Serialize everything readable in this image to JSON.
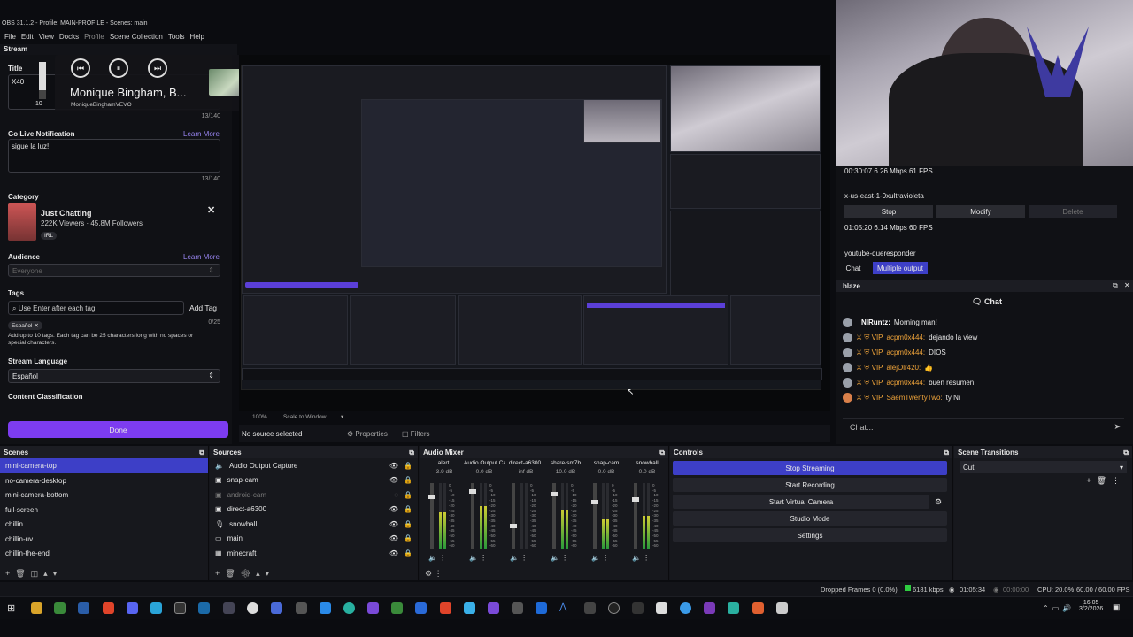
{
  "window": {
    "title": "OBS 31.1.2 - Profile: MAIN-PROFILE - Scenes: main"
  },
  "menu": [
    "File",
    "Edit",
    "View",
    "Docks",
    "Profile",
    "Scene Collection",
    "Tools",
    "Help"
  ],
  "stream_dock": {
    "header": "Stream",
    "title_label": "Title",
    "title_value": "X40",
    "title_count": "13/140",
    "golive_label": "Go Live Notification",
    "golive_link": "Learn More",
    "golive_value": "sigue la luz!",
    "golive_count": "13/140",
    "category_label": "Category",
    "category_name": "Just Chatting",
    "category_stats": "222K Viewers · 45.8M Followers",
    "category_tag": "IRL",
    "audience_label": "Audience",
    "audience_link": "Learn More",
    "audience_value": "Everyone",
    "tags_label": "Tags",
    "tags_placeholder": "Use Enter after each tag",
    "add_tag": "Add Tag",
    "tags_count": "0/25",
    "tag_chip": "Español",
    "tags_help": "Add up to 10 tags. Each tag can be 25 characters long with no spaces or special characters.",
    "lang_label": "Stream Language",
    "lang_value": "Español",
    "content_label": "Content Classification",
    "done": "Done"
  },
  "media": {
    "artist": "Monique Bingham, B...",
    "channel": "MoniqueBinghamVEVO",
    "volume": "10"
  },
  "preview": {
    "zoom": "100%",
    "scale": "Scale to Window",
    "no_source": "No source selected",
    "properties": "Properties",
    "filters": "Filters"
  },
  "right": {
    "time1": "00:30:07",
    "rate1": "6.26 Mbps",
    "fps1": "61 FPS",
    "server": "x-us-east-1-0xultravioleta",
    "stop": "Stop",
    "modify": "Modify",
    "delete": "Delete",
    "time2": "01:05:20",
    "rate2": "6.14 Mbps",
    "fps2": "60 FPS",
    "service": "youtube-queresponder",
    "tab_chat": "Chat",
    "tab_multi": "Multiple output",
    "chat_dock": "blaze",
    "chat_title": "Chat",
    "messages": [
      {
        "user": "NIRuntz:",
        "text": "Morning man!",
        "vip": false
      },
      {
        "user": "acpm0x444:",
        "text": "dejando la view",
        "vip": true
      },
      {
        "user": "acpm0x444:",
        "text": "DIOS",
        "vip": true
      },
      {
        "user": "alejOlr420:",
        "text": "👍",
        "vip": true
      },
      {
        "user": "acpm0x444:",
        "text": "buen resumen",
        "vip": true
      },
      {
        "user": "SaemTwentyTwo:",
        "text": "ty Ni",
        "vip": true
      }
    ],
    "chat_placeholder": "Chat..."
  },
  "scenes": {
    "header": "Scenes",
    "items": [
      "mini-camera-top",
      "no-camera-desktop",
      "mini-camera-bottom",
      "full-screen",
      "chillin",
      "chillin-uv",
      "chillin-the-end"
    ]
  },
  "sources": {
    "header": "Sources",
    "items": [
      "Audio Output Capture",
      "snap-cam",
      "android-cam",
      "direct-a6300",
      "snowball",
      "main",
      "minecraft"
    ]
  },
  "mixer": {
    "header": "Audio Mixer",
    "channels": [
      {
        "name": "alert",
        "db": "-3.9 dB",
        "level": 0.55
      },
      {
        "name": "Audio Output Captu",
        "db": "0.0 dB",
        "level": 0.65
      },
      {
        "name": "direct-a6300",
        "db": "-inf dB",
        "level": 0.0
      },
      {
        "name": "share-sm7b",
        "db": "10.0 dB",
        "level": 0.6
      },
      {
        "name": "snap-cam",
        "db": "0.0 dB",
        "level": 0.45
      },
      {
        "name": "snowball",
        "db": "0.0 dB",
        "level": 0.5
      }
    ],
    "scale": [
      "0",
      "-5",
      "-10",
      "-15",
      "-20",
      "-25",
      "-30",
      "-35",
      "-40",
      "-45",
      "-50",
      "-55",
      "-60"
    ]
  },
  "controls": {
    "header": "Controls",
    "buttons": [
      "Stop Streaming",
      "Start Recording",
      "Start Virtual Camera",
      "Studio Mode",
      "Settings"
    ]
  },
  "transitions": {
    "header": "Scene Transitions",
    "value": "Cut"
  },
  "status": {
    "dropped": "Dropped Frames 0 (0.0%)",
    "kbps": "6181 kbps",
    "live": "01:05:34",
    "rec": "00:00:00",
    "cpu": "CPU: 20.0%",
    "fps": "60.00 / 60.00 FPS"
  },
  "clock": {
    "time": "16:05",
    "date": "3/2/2026"
  },
  "colors": {
    "accent": "#3d3fc7",
    "purple": "#7d3cf0",
    "vip": "#f0a43a"
  }
}
